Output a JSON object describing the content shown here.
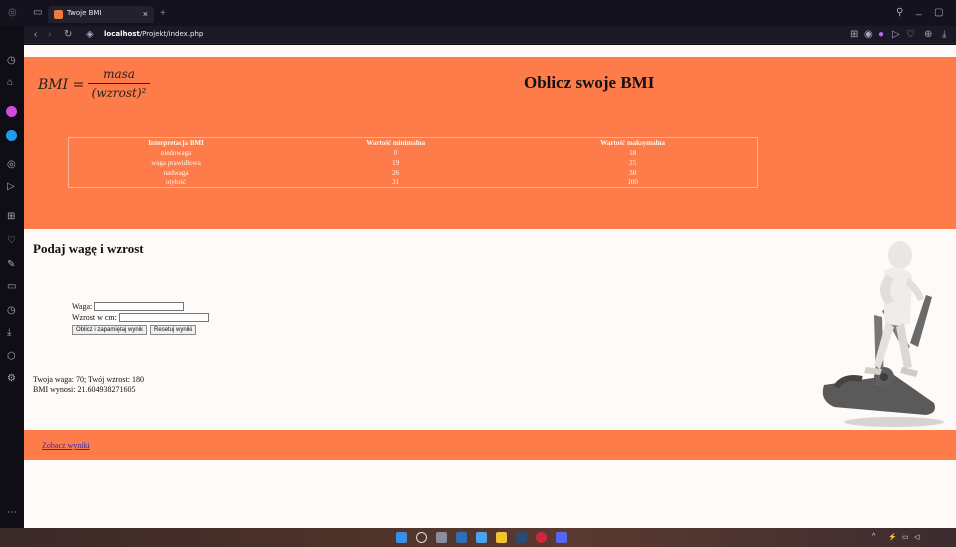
{
  "browser": {
    "tab_title": "Twoje BMI",
    "tab_close": "×",
    "new_tab": "+",
    "url_host": "localhost",
    "url_path": "/Projekt/index.php",
    "accent": "#f07a3c"
  },
  "header": {
    "formula_lhs": "BMI =",
    "formula_num": "masa",
    "formula_den": "(wzrost)²",
    "title": "Oblicz swoje BMI",
    "bg": "#fe7c4a"
  },
  "table": {
    "headers": [
      "Interpretacja BMI",
      "Wartość minimalna",
      "Wartość maksymalna"
    ],
    "rows": [
      [
        "niedowaga",
        "0",
        "18"
      ],
      [
        "waga prawidłowa",
        "19",
        "25"
      ],
      [
        "nadwaga",
        "26",
        "30"
      ],
      [
        "otyłość",
        "31",
        "100"
      ]
    ]
  },
  "form": {
    "section_title": "Podaj wagę i wzrost",
    "weight_label": "Waga:",
    "weight_value": "",
    "height_label": "Wzrost w cm:",
    "height_value": "",
    "submit_label": "Oblicz i zapamiętaj wynik",
    "reset_label": "Resetuj wyniki"
  },
  "result": {
    "line1": "Twoja waga: 70; Twój wzrost: 180",
    "line2": "BMI wynosi: 21.604938271605"
  },
  "footer": {
    "link_label": "Zobacz wyniki"
  },
  "icons": {
    "sidebar": [
      "clock-icon",
      "bag-icon",
      "messenger-icon",
      "twitter-icon",
      "music-icon",
      "play-icon",
      "grid-icon",
      "heart-icon",
      "edit-icon",
      "wallet-icon",
      "history-icon",
      "download-icon",
      "cube-icon",
      "settings-icon"
    ],
    "toolbar": [
      "back-icon",
      "forward-icon",
      "reload-icon",
      "shield-icon"
    ]
  }
}
